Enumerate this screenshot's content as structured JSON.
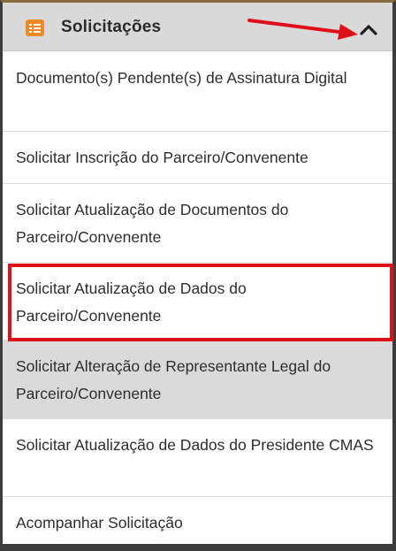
{
  "header": {
    "title": "Solicitações",
    "icon": "list-icon",
    "toggle_icon": "chevron-up-icon",
    "accent_color": "#f08a24",
    "annotation_arrow_color": "#e0101b"
  },
  "menu": {
    "items": [
      {
        "label": "Documento(s) Pendente(s) de Assinatura Digital"
      },
      {
        "label": "Solicitar Inscrição do Parceiro/Convenente"
      },
      {
        "label": "Solicitar Atualização de Documentos do Parceiro/Convenente"
      },
      {
        "label": "Solicitar Atualização de Dados do Parceiro/Convenente",
        "highlighted": true
      },
      {
        "label": "Solicitar Alteração de Representante Legal do Parceiro/Convenente",
        "hovered": true
      },
      {
        "label": "Solicitar Atualização de Dados do Presidente CMAS"
      },
      {
        "label": "Acompanhar Solicitação"
      }
    ]
  },
  "highlight_color": "#e0101b"
}
